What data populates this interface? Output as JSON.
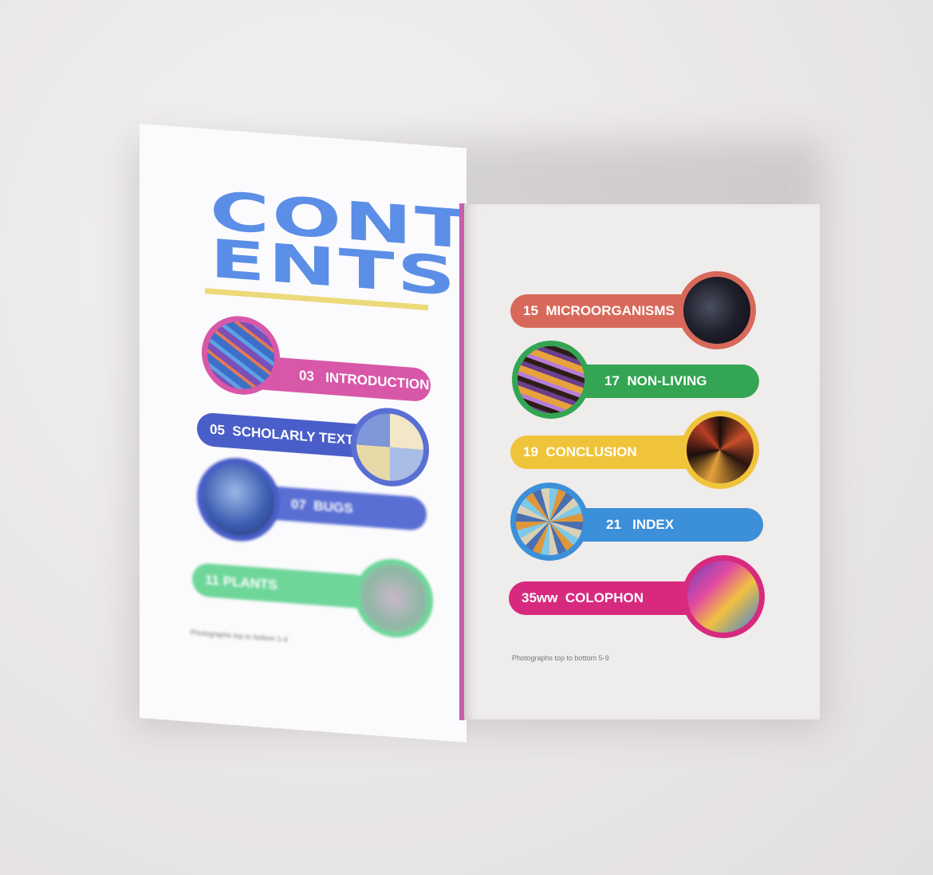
{
  "left_page": {
    "title_line1": "CONT",
    "title_line2": "ENTS",
    "entries": [
      {
        "page": "03",
        "label": "INTRODUCTION",
        "color": "#d857a8"
      },
      {
        "page": "05",
        "label": "SCHOLARLY TEXT",
        "color": "#4a5ec9"
      },
      {
        "page": "07",
        "label": "BUGS",
        "color": "#5a6fd4"
      },
      {
        "page": "11",
        "label": "PLANTS",
        "color": "#6fd69a"
      }
    ],
    "caption": "Photographs top to bottom  1-4"
  },
  "right_page": {
    "entries": [
      {
        "page": "15",
        "label": "MICROORGANISMS",
        "color": "#d8695a"
      },
      {
        "page": "17",
        "label": "NON-LIVING",
        "color": "#34a552"
      },
      {
        "page": "19",
        "label": "CONCLUSION",
        "color": "#f0c43a"
      },
      {
        "page": "21",
        "label": "INDEX",
        "color": "#3c8fd9"
      },
      {
        "page": "35ww",
        "label": "COLOPHON",
        "color": "#d72a7e"
      }
    ],
    "caption": "Photographs top to bottom  5-9"
  }
}
